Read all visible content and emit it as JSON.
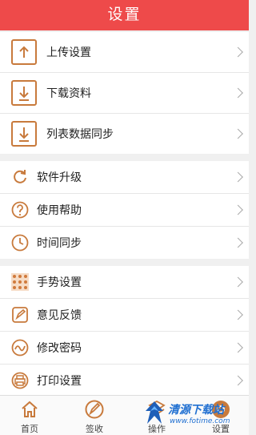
{
  "header": {
    "title": "设置"
  },
  "groups": [
    {
      "items": [
        {
          "label": "上传设置",
          "icon": "upload-icon"
        },
        {
          "label": "下载资料",
          "icon": "download-icon"
        },
        {
          "label": "列表数据同步",
          "icon": "list-sync-icon"
        }
      ]
    },
    {
      "items": [
        {
          "label": "软件升级",
          "icon": "refresh-icon"
        },
        {
          "label": "使用帮助",
          "icon": "help-icon"
        },
        {
          "label": "时间同步",
          "icon": "clock-icon"
        }
      ]
    },
    {
      "items": [
        {
          "label": "手势设置",
          "icon": "gesture-grid-icon"
        },
        {
          "label": "意见反馈",
          "icon": "feedback-icon"
        },
        {
          "label": "修改密码",
          "icon": "password-icon"
        },
        {
          "label": "打印设置",
          "icon": "printer-icon"
        }
      ]
    }
  ],
  "tabbar": {
    "items": [
      {
        "label": "首页",
        "icon": "home-icon"
      },
      {
        "label": "签收",
        "icon": "sign-icon"
      },
      {
        "label": "操作",
        "icon": "operate-icon"
      },
      {
        "label": "设置",
        "icon": "settings-icon"
      }
    ]
  },
  "watermark": {
    "text": "清源下载站",
    "url": "www.fotime.com"
  },
  "colors": {
    "header": "#ee4a4a",
    "icon": "#c87a3c",
    "background": "#f0f0f0"
  }
}
